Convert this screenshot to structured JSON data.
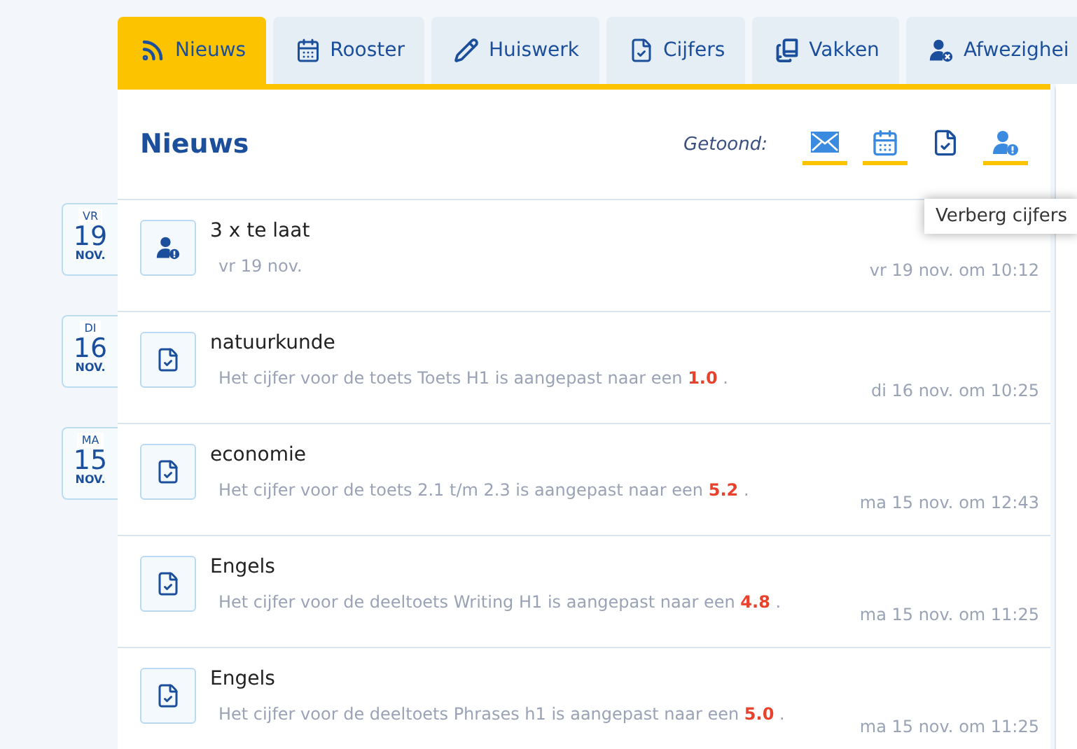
{
  "tabs": [
    {
      "label": "Nieuws",
      "kind": "rss",
      "selected": true
    },
    {
      "label": "Rooster",
      "kind": "calendar",
      "selected": false
    },
    {
      "label": "Huiswerk",
      "kind": "pencil",
      "selected": false
    },
    {
      "label": "Cijfers",
      "kind": "grade",
      "selected": false
    },
    {
      "label": "Vakken",
      "kind": "books",
      "selected": false
    },
    {
      "label": "Afwezighei",
      "kind": "absence",
      "selected": false
    }
  ],
  "panel": {
    "title": "Nieuws",
    "filter_label": "Getoond:",
    "filters": [
      {
        "kind": "mail",
        "active": true
      },
      {
        "kind": "calendar",
        "active": true
      },
      {
        "kind": "grade",
        "active": false
      },
      {
        "kind": "absence",
        "active": true
      }
    ],
    "tooltip": "Verberg cijfers"
  },
  "items": [
    {
      "kind": "absence",
      "date": {
        "weekday": "VR",
        "day": "19",
        "month": "NOV."
      },
      "title": "3 x te laat",
      "message": "vr 19 nov.",
      "time": "vr 19 nov. om 10:12"
    },
    {
      "kind": "grade",
      "date": {
        "weekday": "DI",
        "day": "16",
        "month": "NOV."
      },
      "title": "natuurkunde",
      "message": "Het cijfer voor de toets Toets H1 is aangepast naar een",
      "grade": "1.0",
      "end": ".",
      "time": "di 16 nov. om 10:25"
    },
    {
      "kind": "grade",
      "date": {
        "weekday": "MA",
        "day": "15",
        "month": "NOV."
      },
      "title": "economie",
      "message": "Het cijfer voor de toets 2.1 t/m 2.3 is aangepast naar een",
      "grade": "5.2",
      "end": ".",
      "time": "ma 15 nov. om 12:43"
    },
    {
      "kind": "grade",
      "title": "Engels",
      "message": "Het cijfer voor de deeltoets Writing H1 is aangepast naar een",
      "grade": "4.8",
      "end": ".",
      "time": "ma 15 nov. om 11:25"
    },
    {
      "kind": "grade",
      "title": "Engels",
      "message": "Het cijfer voor de deeltoets Phrases h1 is aangepast naar een",
      "grade": "5.0",
      "end": ".",
      "time": "ma 15 nov. om 11:25"
    }
  ]
}
